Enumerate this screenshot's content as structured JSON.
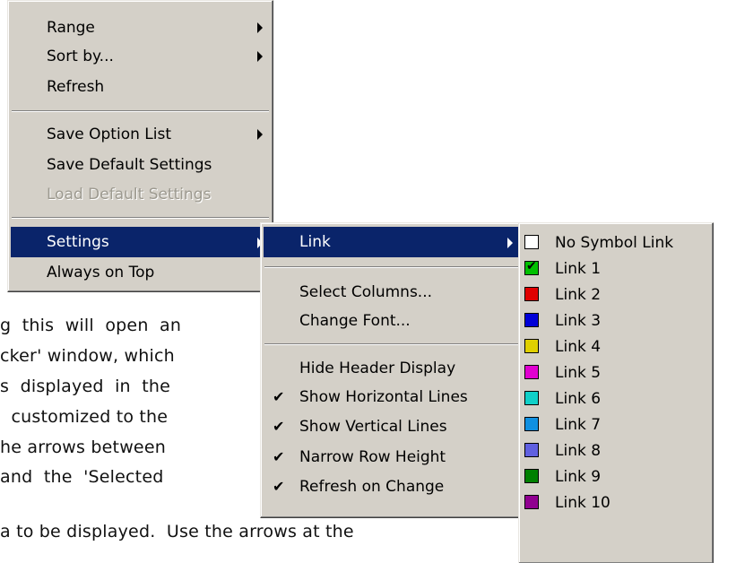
{
  "background_text": [
    "g  this  will  open  an",
    "cker' window, which",
    "s  displayed  in  the",
    "  customized to the",
    "he arrows between",
    "and  the  'Selected",
    "a to be displayed.  Use the arrows at the"
  ],
  "context_menu": {
    "items": [
      {
        "label": "Range",
        "submenu": true
      },
      {
        "label": "Sort by...",
        "submenu": true
      },
      {
        "label": "Refresh"
      },
      {
        "label": "Save Option List",
        "submenu": true
      },
      {
        "label": "Save Default Settings"
      },
      {
        "label": "Load Default Settings",
        "disabled": true
      },
      {
        "label": "Settings",
        "submenu": true,
        "selected": true
      },
      {
        "label": "Always on Top"
      }
    ]
  },
  "settings_menu": {
    "items": [
      {
        "label": "Link",
        "submenu": true,
        "selected": true
      },
      {
        "label": "Select Columns..."
      },
      {
        "label": "Change Font..."
      },
      {
        "label": "Hide Header Display"
      },
      {
        "label": "Show Horizontal Lines",
        "checked": true
      },
      {
        "label": "Show Vertical Lines",
        "checked": true
      },
      {
        "label": "Narrow Row Height",
        "checked": true
      },
      {
        "label": "Refresh on Change",
        "checked": true
      }
    ]
  },
  "link_menu": {
    "items": [
      {
        "label": "No Symbol Link",
        "color": "#ffffff"
      },
      {
        "label": "Link 1",
        "color": "#00c000",
        "checked": true
      },
      {
        "label": "Link 2",
        "color": "#e00000"
      },
      {
        "label": "Link 3",
        "color": "#0000d8"
      },
      {
        "label": "Link 4",
        "color": "#e0d000"
      },
      {
        "label": "Link 5",
        "color": "#e000d0"
      },
      {
        "label": "Link 6",
        "color": "#10d0c8"
      },
      {
        "label": "Link 7",
        "color": "#1090e0"
      },
      {
        "label": "Link 8",
        "color": "#6060e0"
      },
      {
        "label": "Link 9",
        "color": "#008000"
      },
      {
        "label": "Link 10",
        "color": "#900090"
      }
    ]
  },
  "icons": {
    "submenu_arrow": "chevron-right-icon",
    "check": "checkmark-icon"
  },
  "selection_color": "#0a246a",
  "menu_face_color": "#d4d0c8"
}
